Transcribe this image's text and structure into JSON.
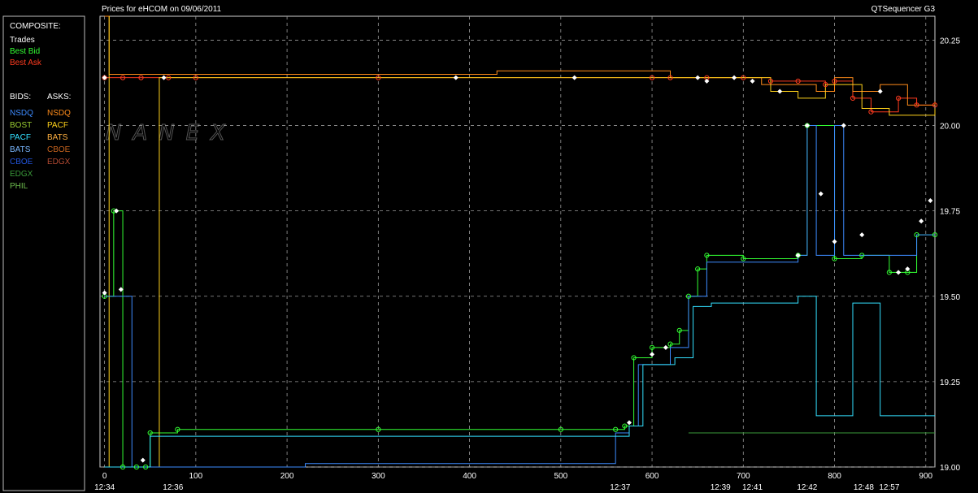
{
  "header": {
    "title": "Prices for  eHCOM  on  09/06/2011",
    "app_name": "QTSequencer G3"
  },
  "watermark": "NANEX",
  "legend": {
    "composite_label": "COMPOSITE:",
    "composite": [
      {
        "label": "Trades",
        "color": "#ffffff"
      },
      {
        "label": "Best Bid",
        "color": "#33ff33"
      },
      {
        "label": "Best Ask",
        "color": "#ff3b1f"
      }
    ],
    "bids_label": "BIDS:",
    "asks_label": "ASKS:",
    "bids": [
      {
        "label": "NSDQ",
        "color": "#3d8bff"
      },
      {
        "label": "BOST",
        "color": "#9acd32"
      },
      {
        "label": "PACF",
        "color": "#33e0ff"
      },
      {
        "label": "BATS",
        "color": "#7ab8ff"
      },
      {
        "label": "CBOE",
        "color": "#2255dd"
      },
      {
        "label": "EDGX",
        "color": "#3a9a3a"
      },
      {
        "label": "PHIL",
        "color": "#6fbf4f"
      }
    ],
    "asks": [
      {
        "label": "NSDQ",
        "color": "#ff8c1a"
      },
      {
        "label": "PACF",
        "color": "#ffd21a"
      },
      {
        "label": "BATS",
        "color": "#ffb040"
      },
      {
        "label": "CBOE",
        "color": "#c8641e"
      },
      {
        "label": "EDGX",
        "color": "#b44a32"
      }
    ]
  },
  "chart_data": {
    "type": "line",
    "xlim": [
      -5,
      910
    ],
    "ylim": [
      19.0,
      20.32
    ],
    "x_ticks": [
      0,
      100,
      200,
      300,
      400,
      500,
      600,
      700,
      800,
      900
    ],
    "x_tick_labels": [
      "0",
      "100",
      "200",
      "300",
      "400",
      "500",
      "600",
      "700",
      "800",
      "900"
    ],
    "time_ticks": [
      {
        "x": 0,
        "label": "12:34"
      },
      {
        "x": 75,
        "label": "12:36"
      },
      {
        "x": 565,
        "label": "12:37"
      },
      {
        "x": 675,
        "label": "12:39"
      },
      {
        "x": 710,
        "label": "12:41"
      },
      {
        "x": 770,
        "label": "12:42"
      },
      {
        "x": 832,
        "label": "12:48"
      },
      {
        "x": 860,
        "label": "12:57"
      }
    ],
    "y_ticks": [
      19.0,
      19.25,
      19.5,
      19.75,
      20.0,
      20.25
    ],
    "y_tick_labels": [
      "19.00",
      "19.25",
      "19.50",
      "19.75",
      "20.00",
      "20.25"
    ],
    "grid": true,
    "series": [
      {
        "name": "Best Ask",
        "color": "#ff3b1f",
        "points": [
          [
            0,
            20.14
          ],
          [
            20,
            20.14
          ],
          [
            40,
            20.14
          ],
          [
            70,
            20.14
          ],
          [
            100,
            20.14
          ],
          [
            300,
            20.14
          ],
          [
            600,
            20.14
          ],
          [
            620,
            20.14
          ],
          [
            660,
            20.14
          ],
          [
            700,
            20.14
          ],
          [
            730,
            20.13
          ],
          [
            760,
            20.13
          ],
          [
            790,
            20.12
          ],
          [
            800,
            20.13
          ],
          [
            820,
            20.08
          ],
          [
            840,
            20.04
          ],
          [
            870,
            20.08
          ],
          [
            890,
            20.06
          ],
          [
            910,
            20.06
          ]
        ]
      },
      {
        "name": "Best Bid",
        "color": "#33ff33",
        "points": [
          [
            0,
            19.5
          ],
          [
            10,
            19.75
          ],
          [
            20,
            19.0
          ],
          [
            35,
            19.0
          ],
          [
            45,
            19.0
          ],
          [
            50,
            19.1
          ],
          [
            80,
            19.11
          ],
          [
            300,
            19.11
          ],
          [
            500,
            19.11
          ],
          [
            560,
            19.11
          ],
          [
            570,
            19.12
          ],
          [
            580,
            19.32
          ],
          [
            600,
            19.35
          ],
          [
            620,
            19.36
          ],
          [
            630,
            19.4
          ],
          [
            640,
            19.5
          ],
          [
            650,
            19.58
          ],
          [
            660,
            19.62
          ],
          [
            700,
            19.61
          ],
          [
            760,
            19.62
          ],
          [
            770,
            20.0
          ],
          [
            800,
            19.61
          ],
          [
            830,
            19.62
          ],
          [
            860,
            19.57
          ],
          [
            880,
            19.57
          ],
          [
            890,
            19.68
          ],
          [
            910,
            19.68
          ]
        ]
      },
      {
        "name": "NSDQ Ask",
        "color": "#ff8c1a",
        "points": [
          [
            0,
            20.32
          ],
          [
            5,
            20.32
          ],
          [
            5,
            20.15
          ],
          [
            220,
            20.15
          ],
          [
            220,
            20.15
          ],
          [
            430,
            20.15
          ],
          [
            430,
            20.16
          ],
          [
            620,
            20.16
          ],
          [
            620,
            20.14
          ],
          [
            700,
            20.14
          ],
          [
            720,
            20.12
          ],
          [
            760,
            20.12
          ],
          [
            780,
            20.1
          ],
          [
            800,
            20.14
          ],
          [
            820,
            20.1
          ],
          [
            850,
            20.12
          ],
          [
            880,
            20.06
          ],
          [
            910,
            20.07
          ]
        ]
      },
      {
        "name": "PACF Ask",
        "color": "#ffd21a",
        "points": [
          [
            5,
            20.32
          ],
          [
            5,
            19.0
          ],
          [
            60,
            19.0
          ],
          [
            60,
            20.14
          ],
          [
            700,
            20.14
          ],
          [
            730,
            20.1
          ],
          [
            760,
            20.08
          ],
          [
            790,
            20.12
          ],
          [
            830,
            20.05
          ],
          [
            860,
            20.03
          ],
          [
            910,
            20.05
          ]
        ]
      },
      {
        "name": "NSDQ Bid",
        "color": "#3d8bff",
        "points": [
          [
            0,
            19.5
          ],
          [
            30,
            19.5
          ],
          [
            30,
            19.0
          ],
          [
            220,
            19.0
          ],
          [
            220,
            19.01
          ],
          [
            240,
            19.01
          ],
          [
            500,
            19.01
          ],
          [
            560,
            19.01
          ],
          [
            560,
            19.1
          ],
          [
            575,
            19.12
          ],
          [
            585,
            19.3
          ],
          [
            620,
            19.35
          ],
          [
            640,
            19.5
          ],
          [
            660,
            19.6
          ],
          [
            760,
            19.62
          ],
          [
            770,
            20.0
          ],
          [
            780,
            19.62
          ],
          [
            800,
            20.0
          ],
          [
            810,
            19.62
          ],
          [
            890,
            19.68
          ],
          [
            910,
            19.68
          ]
        ]
      },
      {
        "name": "PACF Bid",
        "color": "#33e0ff",
        "points": [
          [
            0,
            19.0
          ],
          [
            50,
            19.0
          ],
          [
            50,
            19.09
          ],
          [
            560,
            19.09
          ],
          [
            575,
            19.12
          ],
          [
            590,
            19.3
          ],
          [
            625,
            19.32
          ],
          [
            645,
            19.47
          ],
          [
            665,
            19.48
          ],
          [
            700,
            19.48
          ],
          [
            760,
            19.5
          ],
          [
            780,
            19.5
          ],
          [
            780,
            19.15
          ],
          [
            810,
            19.15
          ],
          [
            820,
            19.48
          ],
          [
            850,
            19.48
          ],
          [
            850,
            19.15
          ],
          [
            910,
            19.15
          ]
        ]
      },
      {
        "name": "EDGX Bid",
        "color": "#3a9a3a",
        "points": [
          [
            640,
            19.1
          ],
          [
            700,
            19.1
          ],
          [
            760,
            19.1
          ],
          [
            790,
            19.1
          ],
          [
            830,
            19.1
          ],
          [
            910,
            19.1
          ]
        ]
      }
    ],
    "trades": [
      [
        0,
        20.14
      ],
      [
        0,
        19.51
      ],
      [
        13,
        19.75
      ],
      [
        18,
        19.52
      ],
      [
        42,
        19.02
      ],
      [
        65,
        20.14
      ],
      [
        385,
        20.14
      ],
      [
        515,
        20.14
      ],
      [
        575,
        19.13
      ],
      [
        600,
        19.33
      ],
      [
        615,
        19.35
      ],
      [
        650,
        20.14
      ],
      [
        660,
        20.13
      ],
      [
        690,
        20.14
      ],
      [
        710,
        20.13
      ],
      [
        740,
        20.1
      ],
      [
        760,
        19.62
      ],
      [
        770,
        20.0
      ],
      [
        785,
        19.8
      ],
      [
        800,
        19.66
      ],
      [
        810,
        20.0
      ],
      [
        830,
        19.68
      ],
      [
        850,
        20.1
      ],
      [
        870,
        19.57
      ],
      [
        880,
        19.58
      ],
      [
        895,
        19.72
      ],
      [
        905,
        19.78
      ]
    ]
  }
}
